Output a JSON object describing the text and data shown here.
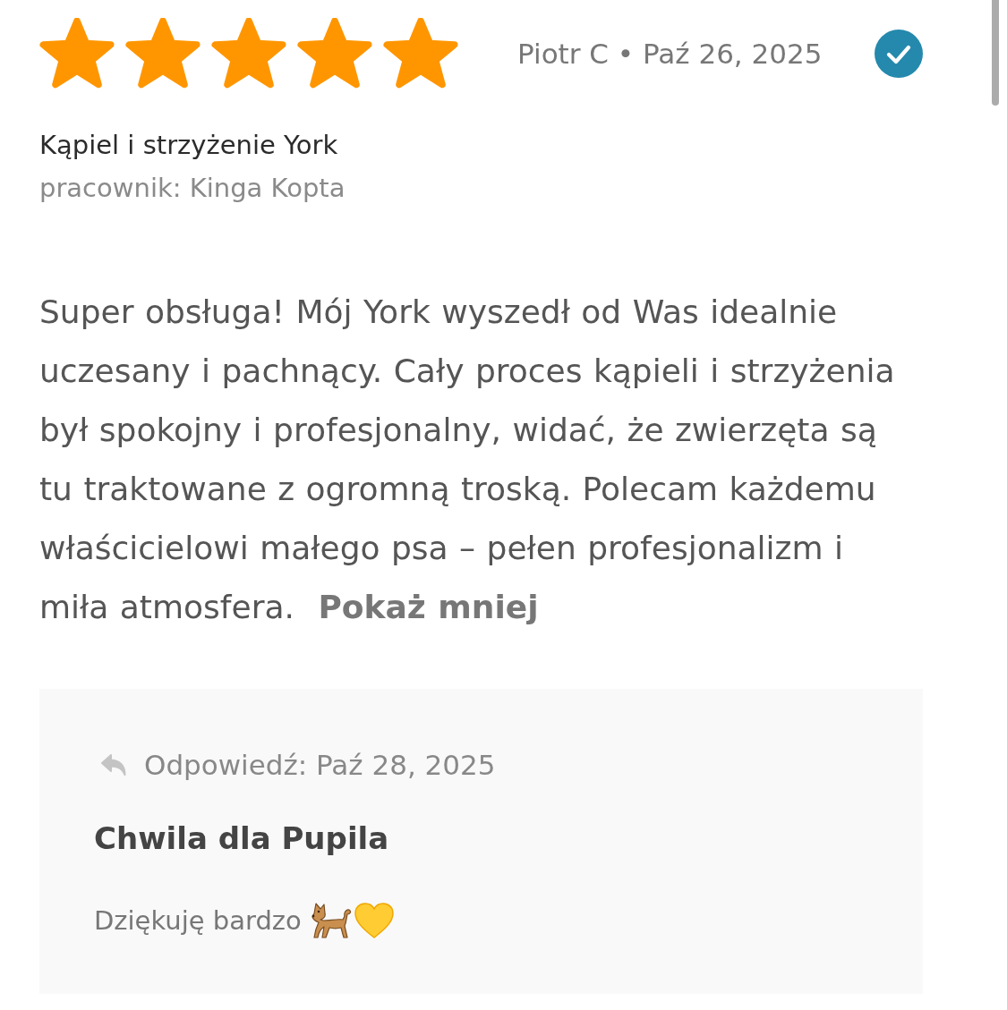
{
  "review": {
    "stars": 5,
    "byline": "Piotr C • Paź 26, 2025",
    "verified": true,
    "service": "Kąpiel i strzyżenie York",
    "staff": "pracownik: Kinga Kopta",
    "text": "Super obsługa! Mój York wyszedł od Was idealnie uczesany i pachnący. Cały proces kąpieli i strzyżenia był spokojny i profesjonalny, widać, że zwierzęta są tu traktowane z ogromną troską. Polecam każdemu właścicielowi małego psa – pełen profesjonalizm i miła atmosfera.",
    "toggle_link": "Pokaż mniej"
  },
  "reply": {
    "label": "Odpowiedź: Paź 28, 2025",
    "business_name": "Chwila dla Pupila",
    "text": "Dziękuję bardzo"
  }
}
